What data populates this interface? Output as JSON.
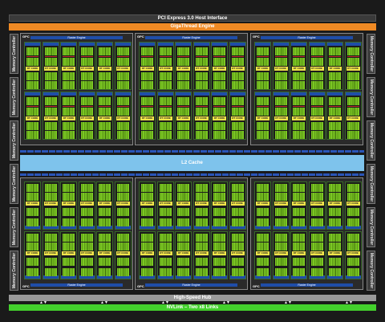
{
  "top": {
    "pcie": "PCI Express 3.0 Host Interface",
    "giga": "GigaThread Engine"
  },
  "memory_controller": "Memory Controller",
  "gpc_label": "GPC",
  "raster_engine": "Raster Engine",
  "rt_core": "RT CORE",
  "l2": "L2 Cache",
  "bottom": {
    "hub": "High-Speed Hub",
    "nvlink": "NVLink – Two x8 Links"
  },
  "colors": {
    "sm_core": "#7bc823",
    "rt_core": "#f2e64a",
    "raster": "#1f4da8",
    "l2": "#7ec3ec",
    "nvlink": "#43d02c",
    "giga": "#f08a24"
  }
}
